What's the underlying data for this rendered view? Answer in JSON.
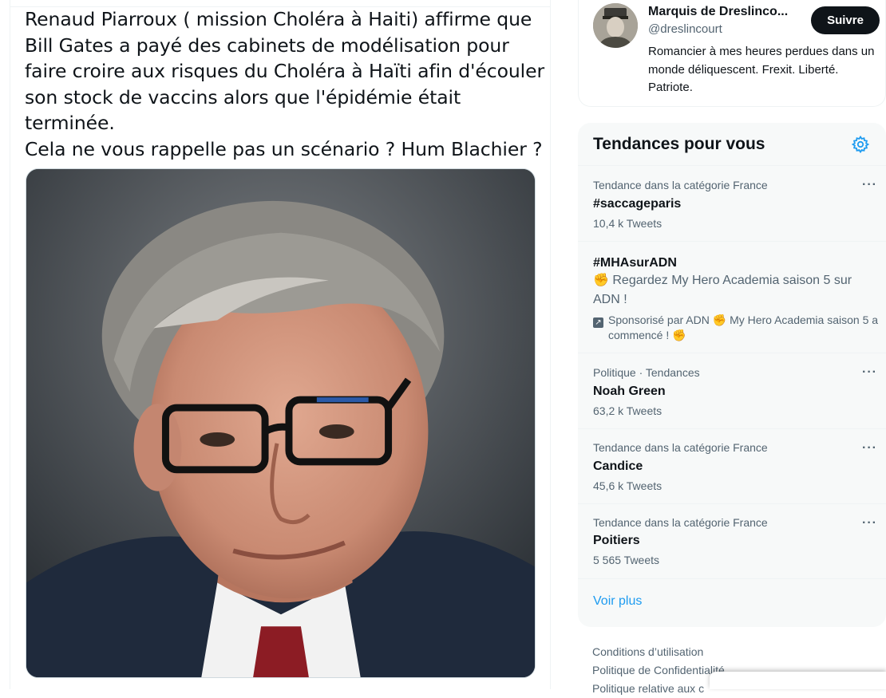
{
  "tweet": {
    "text_lines": [
      "Renaud Piarroux ( mission Choléra à  Haiti) affirme que",
      "Bill Gates a payé des cabinets de modélisation pour",
      "faire croire aux risques du Choléra à Haïti afin d'écouler",
      "son stock de vaccins alors que l'épidémie était",
      "terminée.",
      "Cela ne vous rappelle pas un scénario ? Hum Blachier ?"
    ]
  },
  "who_to_follow": {
    "name": "Marquis de Dreslinco...",
    "handle": "@dreslincourt",
    "follow_label": "Suivre",
    "bio": "Romancier à mes heures perdues dans un monde déliquescent. Frexit. Liberté. Patriote."
  },
  "trends": {
    "title": "Tendances pour vous",
    "items": [
      {
        "context": "Tendance dans la catégorie France",
        "name": "#saccageparis",
        "count": "10,4 k Tweets"
      },
      {
        "context": "Politique · Tendances",
        "name": "Noah Green",
        "count": "63,2 k Tweets"
      },
      {
        "context": "Tendance dans la catégorie France",
        "name": "Candice",
        "count": "45,6 k Tweets"
      },
      {
        "context": "Tendance dans la catégorie France",
        "name": "Poitiers",
        "count": "5 565 Tweets"
      }
    ],
    "promoted": {
      "name": "#MHAsurADN",
      "emoji": "✊",
      "description": "Regardez My Hero Academia saison 5 sur ADN !",
      "sponsor_prefix": "Sponsorisé par ADN",
      "sponsor_text": "My Hero Academia saison 5 a commencé !"
    },
    "show_more": "Voir plus"
  },
  "footer": {
    "links": [
      "Conditions d’utilisation",
      "Politique de Confidentialité",
      "Politique relative aux c"
    ]
  },
  "colors": {
    "accent": "#1d9bf0",
    "text_primary": "#0f1419",
    "text_secondary": "#536471",
    "card_bg": "#f7f9f9",
    "follow_button": "#0f1419"
  },
  "icons": {
    "settings": "gear-icon",
    "more": "more-icon",
    "promoted": "promoted-arrow-icon"
  }
}
